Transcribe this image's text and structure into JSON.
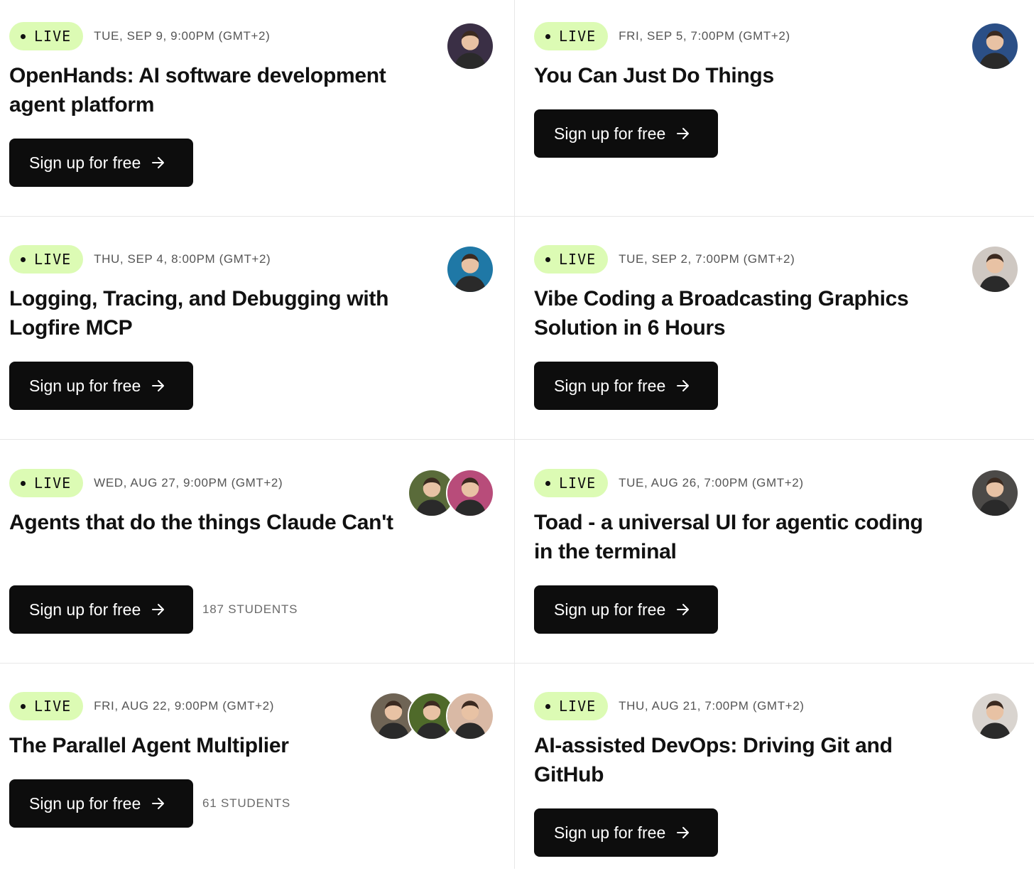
{
  "cards": [
    {
      "status": "LIVE",
      "date": "TUE, SEP 9, 9:00PM (GMT+2)",
      "title": "OpenHands: AI software development agent platform",
      "button": "Sign up for free",
      "students": "",
      "avatars": [
        "#3a2f45"
      ]
    },
    {
      "status": "LIVE",
      "date": "FRI, SEP 5, 7:00PM (GMT+2)",
      "title": "You Can Just Do Things",
      "button": "Sign up for free",
      "students": "",
      "avatars": [
        "#2b4f86"
      ]
    },
    {
      "status": "LIVE",
      "date": "THU, SEP 4, 8:00PM (GMT+2)",
      "title": "Logging, Tracing, and Debugging with Logfire MCP",
      "button": "Sign up for free",
      "students": "",
      "avatars": [
        "#1f78a6"
      ]
    },
    {
      "status": "LIVE",
      "date": "TUE, SEP 2, 7:00PM (GMT+2)",
      "title": "Vibe Coding a Broadcasting Graphics Solution in 6 Hours",
      "button": "Sign up for free",
      "students": "",
      "avatars": [
        "#cfc8c2"
      ]
    },
    {
      "status": "LIVE",
      "date": "WED, AUG 27, 9:00PM (GMT+2)",
      "title": "Agents that do the things Claude Can't",
      "button": "Sign up for free",
      "students": "187 STUDENTS",
      "avatars": [
        "#5a6b3a",
        "#b84c7a"
      ]
    },
    {
      "status": "LIVE",
      "date": "TUE, AUG 26, 7:00PM (GMT+2)",
      "title": "Toad - a universal UI for agentic coding in the terminal",
      "button": "Sign up for free",
      "students": "",
      "avatars": [
        "#4c4a48"
      ]
    },
    {
      "status": "LIVE",
      "date": "FRI, AUG 22, 9:00PM (GMT+2)",
      "title": "The Parallel Agent Multiplier",
      "button": "Sign up for free",
      "students": "61 STUDENTS",
      "avatars": [
        "#6f6455",
        "#4f6a2a",
        "#d9b9a5"
      ]
    },
    {
      "status": "LIVE",
      "date": "THU, AUG 21, 7:00PM (GMT+2)",
      "title": "AI-assisted DevOps: Driving Git and GitHub",
      "button": "Sign up for free",
      "students": "",
      "avatars": [
        "#d9d4cf"
      ]
    }
  ],
  "icons": {
    "arrow": "arrow-right-icon",
    "avatar": "person-avatar-icon"
  }
}
